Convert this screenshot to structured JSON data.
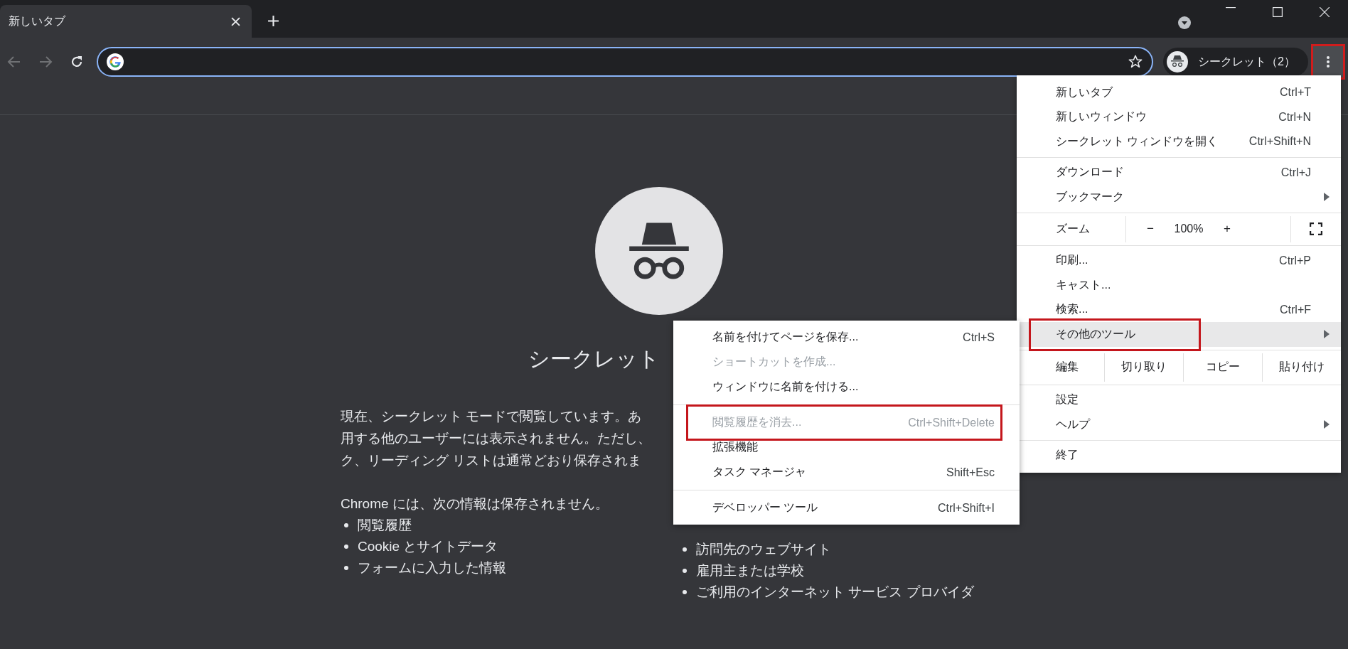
{
  "tabs": [
    {
      "label": "新しいタブ",
      "selected": true
    }
  ],
  "toolbar": {
    "back_disabled": true,
    "forward_disabled": true,
    "profile_label": "シークレット（2）",
    "menu_outlined": true
  },
  "page": {
    "title": "シークレット",
    "paragraph_lines": [
      "現在、シークレット モードで閲覧しています。あ",
      "用する他のユーザーには表示されません。ただし、",
      "ク、リーディング リストは通常どおり保存されま"
    ],
    "not_saved_heading": "Chrome には、次の情報は保存されません。",
    "not_saved": [
      "閲覧履歴",
      "Cookie とサイトデータ",
      "フォームに入力した情報"
    ],
    "visible_to": [
      "訪問先のウェブサイト",
      "雇用主または学校",
      "ご利用のインターネット サービス プロバイダ"
    ]
  },
  "menu": [
    {
      "kind": "item",
      "label": "新しいタブ",
      "shortcut": "Ctrl+T",
      "submenu": false,
      "selected": false,
      "outlined": false
    },
    {
      "kind": "item",
      "label": "新しいウィンドウ",
      "shortcut": "Ctrl+N",
      "submenu": false,
      "selected": false,
      "outlined": false
    },
    {
      "kind": "item",
      "label": "シークレット ウィンドウを開く",
      "shortcut": "Ctrl+Shift+N",
      "submenu": false,
      "selected": false,
      "outlined": false
    },
    {
      "kind": "separator"
    },
    {
      "kind": "item",
      "label": "ダウンロード",
      "shortcut": "Ctrl+J",
      "submenu": false,
      "selected": false,
      "outlined": false
    },
    {
      "kind": "item",
      "label": "ブックマーク",
      "submenu": true,
      "selected": false,
      "outlined": false
    },
    {
      "kind": "separator"
    },
    {
      "kind": "zoom",
      "label": "ズーム",
      "minus": "−",
      "value": "100%",
      "plus": "+"
    },
    {
      "kind": "separator"
    },
    {
      "kind": "item",
      "label": "印刷...",
      "shortcut": "Ctrl+P",
      "submenu": false,
      "selected": false,
      "outlined": false
    },
    {
      "kind": "item",
      "label": "キャスト...",
      "submenu": false,
      "selected": false,
      "outlined": false
    },
    {
      "kind": "item",
      "label": "検索...",
      "shortcut": "Ctrl+F",
      "submenu": false,
      "selected": false,
      "outlined": false
    },
    {
      "kind": "item",
      "label": "その他のツール",
      "submenu": true,
      "selected": true,
      "outlined": true
    },
    {
      "kind": "separator"
    },
    {
      "kind": "edit",
      "label": "編集",
      "actions": [
        "切り取り",
        "コピー",
        "貼り付け"
      ]
    },
    {
      "kind": "separator"
    },
    {
      "kind": "item",
      "label": "設定",
      "submenu": false,
      "selected": false,
      "outlined": false
    },
    {
      "kind": "item",
      "label": "ヘルプ",
      "submenu": true,
      "selected": false,
      "outlined": false
    },
    {
      "kind": "separator"
    },
    {
      "kind": "item",
      "label": "終了",
      "submenu": false,
      "selected": false,
      "outlined": false
    }
  ],
  "submenu": [
    {
      "kind": "item",
      "label": "名前を付けてページを保存...",
      "shortcut": "Ctrl+S",
      "disabled": false,
      "outlined": false
    },
    {
      "kind": "item",
      "label": "ショートカットを作成...",
      "disabled": true,
      "outlined": false
    },
    {
      "kind": "item",
      "label": "ウィンドウに名前を付ける...",
      "disabled": false,
      "outlined": false
    },
    {
      "kind": "separator"
    },
    {
      "kind": "item",
      "label": "閲覧履歴を消去...",
      "shortcut": "Ctrl+Shift+Delete",
      "disabled": true,
      "outlined": true
    },
    {
      "kind": "item",
      "label": "拡張機能",
      "disabled": false,
      "outlined": false
    },
    {
      "kind": "item",
      "label": "タスク マネージャ",
      "shortcut": "Shift+Esc",
      "disabled": false,
      "outlined": false
    },
    {
      "kind": "separator"
    },
    {
      "kind": "item",
      "label": "デベロッパー ツール",
      "shortcut": "Ctrl+Shift+I",
      "disabled": false,
      "outlined": false
    }
  ]
}
